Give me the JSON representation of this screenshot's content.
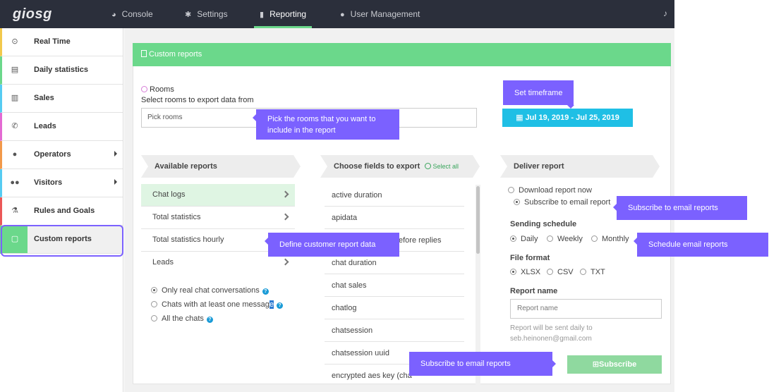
{
  "topbar": {
    "logo": "giosg",
    "nav": [
      {
        "label": "Console",
        "icon": "dashboard-icon"
      },
      {
        "label": "Settings",
        "icon": "gear-icon"
      },
      {
        "label": "Reporting",
        "icon": "bar-chart-icon",
        "active": true
      },
      {
        "label": "User Management",
        "icon": "user-icon"
      }
    ],
    "bell_icon": "bell-icon"
  },
  "sidebar": {
    "items": [
      {
        "label": "Real Time",
        "icon": "clock-icon",
        "color": "#f2c94c"
      },
      {
        "label": "Daily statistics",
        "icon": "calendar-icon",
        "color": "#6bd88b"
      },
      {
        "label": "Sales",
        "icon": "bar-chart-icon",
        "color": "#56ccf2"
      },
      {
        "label": "Leads",
        "icon": "phone-icon",
        "color": "#e36ad3"
      },
      {
        "label": "Operators",
        "icon": "user-icon",
        "color": "#f2994a"
      },
      {
        "label": "Visitors",
        "icon": "users-icon",
        "color": "#56ccf2"
      },
      {
        "label": "Rules and Goals",
        "icon": "flask-icon",
        "color": "#eb5757"
      },
      {
        "label": "Custom reports",
        "icon": "document-icon",
        "color": "#6bd88b",
        "active": true
      }
    ]
  },
  "card": {
    "title": "Custom reports"
  },
  "rooms": {
    "label": "Rooms",
    "subtitle": "Select rooms to export data from",
    "placeholder": "Pick rooms"
  },
  "timeframe": {
    "label": "Jul 19, 2019 - Jul 25, 2019"
  },
  "available_reports": {
    "header": "Available reports",
    "items": [
      "Chat logs",
      "Total statistics",
      "Total statistics hourly",
      "Leads"
    ],
    "filters": [
      {
        "label": "Only real chat conversations",
        "selected": true
      },
      {
        "label": "Chats with at least one messag",
        "tail": "e",
        "selected": false
      },
      {
        "label": "All the chats",
        "selected": false
      }
    ]
  },
  "fields": {
    "header": "Choose fields to export",
    "select_all": "Select all",
    "items": [
      "active duration",
      "apidata",
      "efore replies",
      "chat duration",
      "chat sales",
      "chatlog",
      "chatsession",
      "chatsession uuid",
      "encrypted aes key (cha"
    ]
  },
  "deliver": {
    "header": "Deliver report",
    "download": "Download report now",
    "subscribe": "Subscribe to email report",
    "schedule_label": "Sending schedule",
    "schedule": [
      "Daily",
      "Weekly",
      "Monthly"
    ],
    "format_label": "File format",
    "formats": [
      "XLSX",
      "CSV",
      "TXT"
    ],
    "name_label": "Report name",
    "name_placeholder": "Report name",
    "note_line1": "Report will be sent daily to",
    "note_line2": "seb.heinonen@gmail.com",
    "button": "Subscribe"
  },
  "tooltips": {
    "timeframe": "Set timeframe",
    "rooms_line1": "Pick the rooms that you want to",
    "rooms_line2": "include in the report",
    "subscribe_email": "Subscribe to email reports",
    "schedule": "Schedule email reports",
    "define": "Define customer report data",
    "subscribe_bottom": "Subscribe to email reports"
  },
  "colors": {
    "accent_green": "#6bd88b",
    "tooltip_purple": "#7b61ff",
    "date_blue": "#1fbfe5",
    "topbar": "#2b2f3b"
  }
}
